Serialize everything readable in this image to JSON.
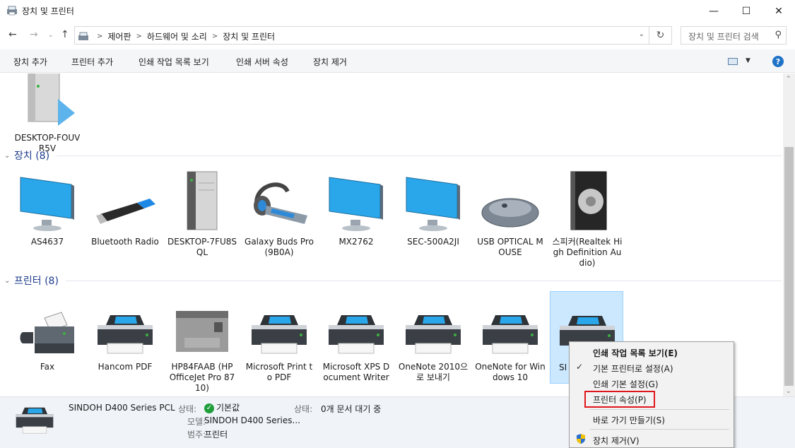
{
  "window": {
    "title": "장치 및 프린터"
  },
  "window_buttons": {
    "minimize": "—",
    "maximize": "☐",
    "close": "✕"
  },
  "nav": {
    "back": "←",
    "forward": "→",
    "recent": "⌄",
    "up": "↑",
    "refresh": "↻",
    "address_dropdown": "⌄"
  },
  "breadcrumbs": [
    "제어판",
    "하드웨어 및 소리",
    "장치 및 프린터"
  ],
  "search": {
    "placeholder": "장치 및 프린터 검색",
    "icon": "⚲"
  },
  "commands": [
    "장치 추가",
    "프린터 추가",
    "인쇄 작업 목록 보기",
    "인쇄 서버 속성",
    "장치 제거"
  ],
  "help": {
    "label": "?"
  },
  "view": {
    "dropdown": "▼"
  },
  "scroll": {
    "up": "⌃",
    "down": "⌄"
  },
  "computer_item": {
    "label": "DESKTOP-FOUV R5V"
  },
  "groups": {
    "devices": {
      "title": "장치 (8)",
      "chevron": "⌄"
    },
    "printers": {
      "title": "프린터 (8)",
      "chevron": "⌄"
    }
  },
  "devices": [
    {
      "label": "AS4637",
      "icon": "monitor-icon"
    },
    {
      "label": "Bluetooth Radio",
      "icon": "usb-dongle-icon"
    },
    {
      "label": "DESKTOP-7FU8S QL",
      "icon": "pc-tower-icon"
    },
    {
      "label": "Galaxy Buds Pro (9B0A)",
      "icon": "headset-icon"
    },
    {
      "label": "MX2762",
      "icon": "monitor-icon"
    },
    {
      "label": "SEC-500A2JI",
      "icon": "monitor-icon"
    },
    {
      "label": "USB OPTICAL MOUSE",
      "icon": "mouse-icon"
    },
    {
      "label": "스피커(Realtek High Definition Audio)",
      "icon": "speaker-icon"
    }
  ],
  "printers": [
    {
      "label": "Fax",
      "icon": "fax-icon"
    },
    {
      "label": "Hancom PDF",
      "icon": "printer-icon"
    },
    {
      "label": "HP84FAAB (HP OfficeJet Pro 8710)",
      "icon": "multifunction-printer-icon"
    },
    {
      "label": "Microsoft Print to PDF",
      "icon": "printer-icon"
    },
    {
      "label": "Microsoft XPS Document Writer",
      "icon": "printer-icon"
    },
    {
      "label": "OneNote 2010으로 보내기",
      "icon": "printer-icon"
    },
    {
      "label": "OneNote for Windows 10",
      "icon": "printer-icon"
    },
    {
      "label": "SI",
      "icon": "printer-icon"
    }
  ],
  "details": {
    "name": "SINDOH D400 Series PCL",
    "status_key": "상태:",
    "status_value": "기본값",
    "model_key": "모델:",
    "model_value": "SINDOH D400 Series...",
    "category_key": "범주:",
    "category_value": "프린터",
    "state_key": "상태:",
    "state_value": "0개 문서 대기 중"
  },
  "context_menu": {
    "items": [
      {
        "label": "인쇄 작업 목록 보기(E)",
        "bold": true
      },
      {
        "label": "기본 프린터로 설정(A)",
        "checked": true
      },
      {
        "label": "인쇄 기본 설정(G)"
      },
      {
        "label": "프린터 속성(P)",
        "highlighted": true
      },
      {
        "label": "바로 가기 만들기(S)"
      },
      {
        "label": "장치 제거(V)",
        "shield": true
      }
    ],
    "check_mark": "✓"
  },
  "colors": {
    "accent": "#1e3c8c",
    "selection": "#cce8ff",
    "highlight_box": "#e0161c",
    "help": "#1e73c8"
  }
}
